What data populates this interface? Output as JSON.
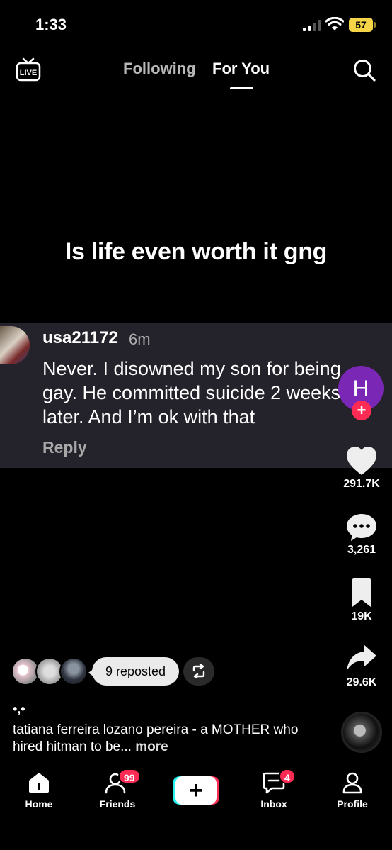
{
  "status_bar": {
    "time": "1:33",
    "battery": "57"
  },
  "top_nav": {
    "live_label": "LIVE",
    "tabs": [
      "Following",
      "For You"
    ]
  },
  "video": {
    "headline": "Is life even worth it gng"
  },
  "comment": {
    "username": "usa21172",
    "time": "6m",
    "lines": [
      "Never. I disowned my son for being",
      "gay. He committed suicide 2 weeks",
      "later. And I’m ok with that"
    ],
    "reply_label": "Reply"
  },
  "creator": {
    "initial": "H",
    "follow_symbol": "+"
  },
  "actions": {
    "likes": "291.7K",
    "comments": "3,261",
    "saves": "19K",
    "shares": "29.6K"
  },
  "reposted": {
    "label": "9 reposted"
  },
  "caption": {
    "dots": "•,•",
    "text": "tatiana ferreira lozano pereira - a MOTHER who hired hitman to be...",
    "more": "more"
  },
  "bottom_nav": {
    "home": "Home",
    "friends": "Friends",
    "friends_badge": "99",
    "create": "+",
    "inbox": "Inbox",
    "inbox_badge": "4",
    "profile": "Profile"
  },
  "colors": {
    "accent_red": "#fe2c55",
    "accent_cyan": "#25f4ee",
    "creator_purple": "#7b27b5",
    "comment_bg": "#24232b",
    "battery_yellow": "#f5d547"
  }
}
